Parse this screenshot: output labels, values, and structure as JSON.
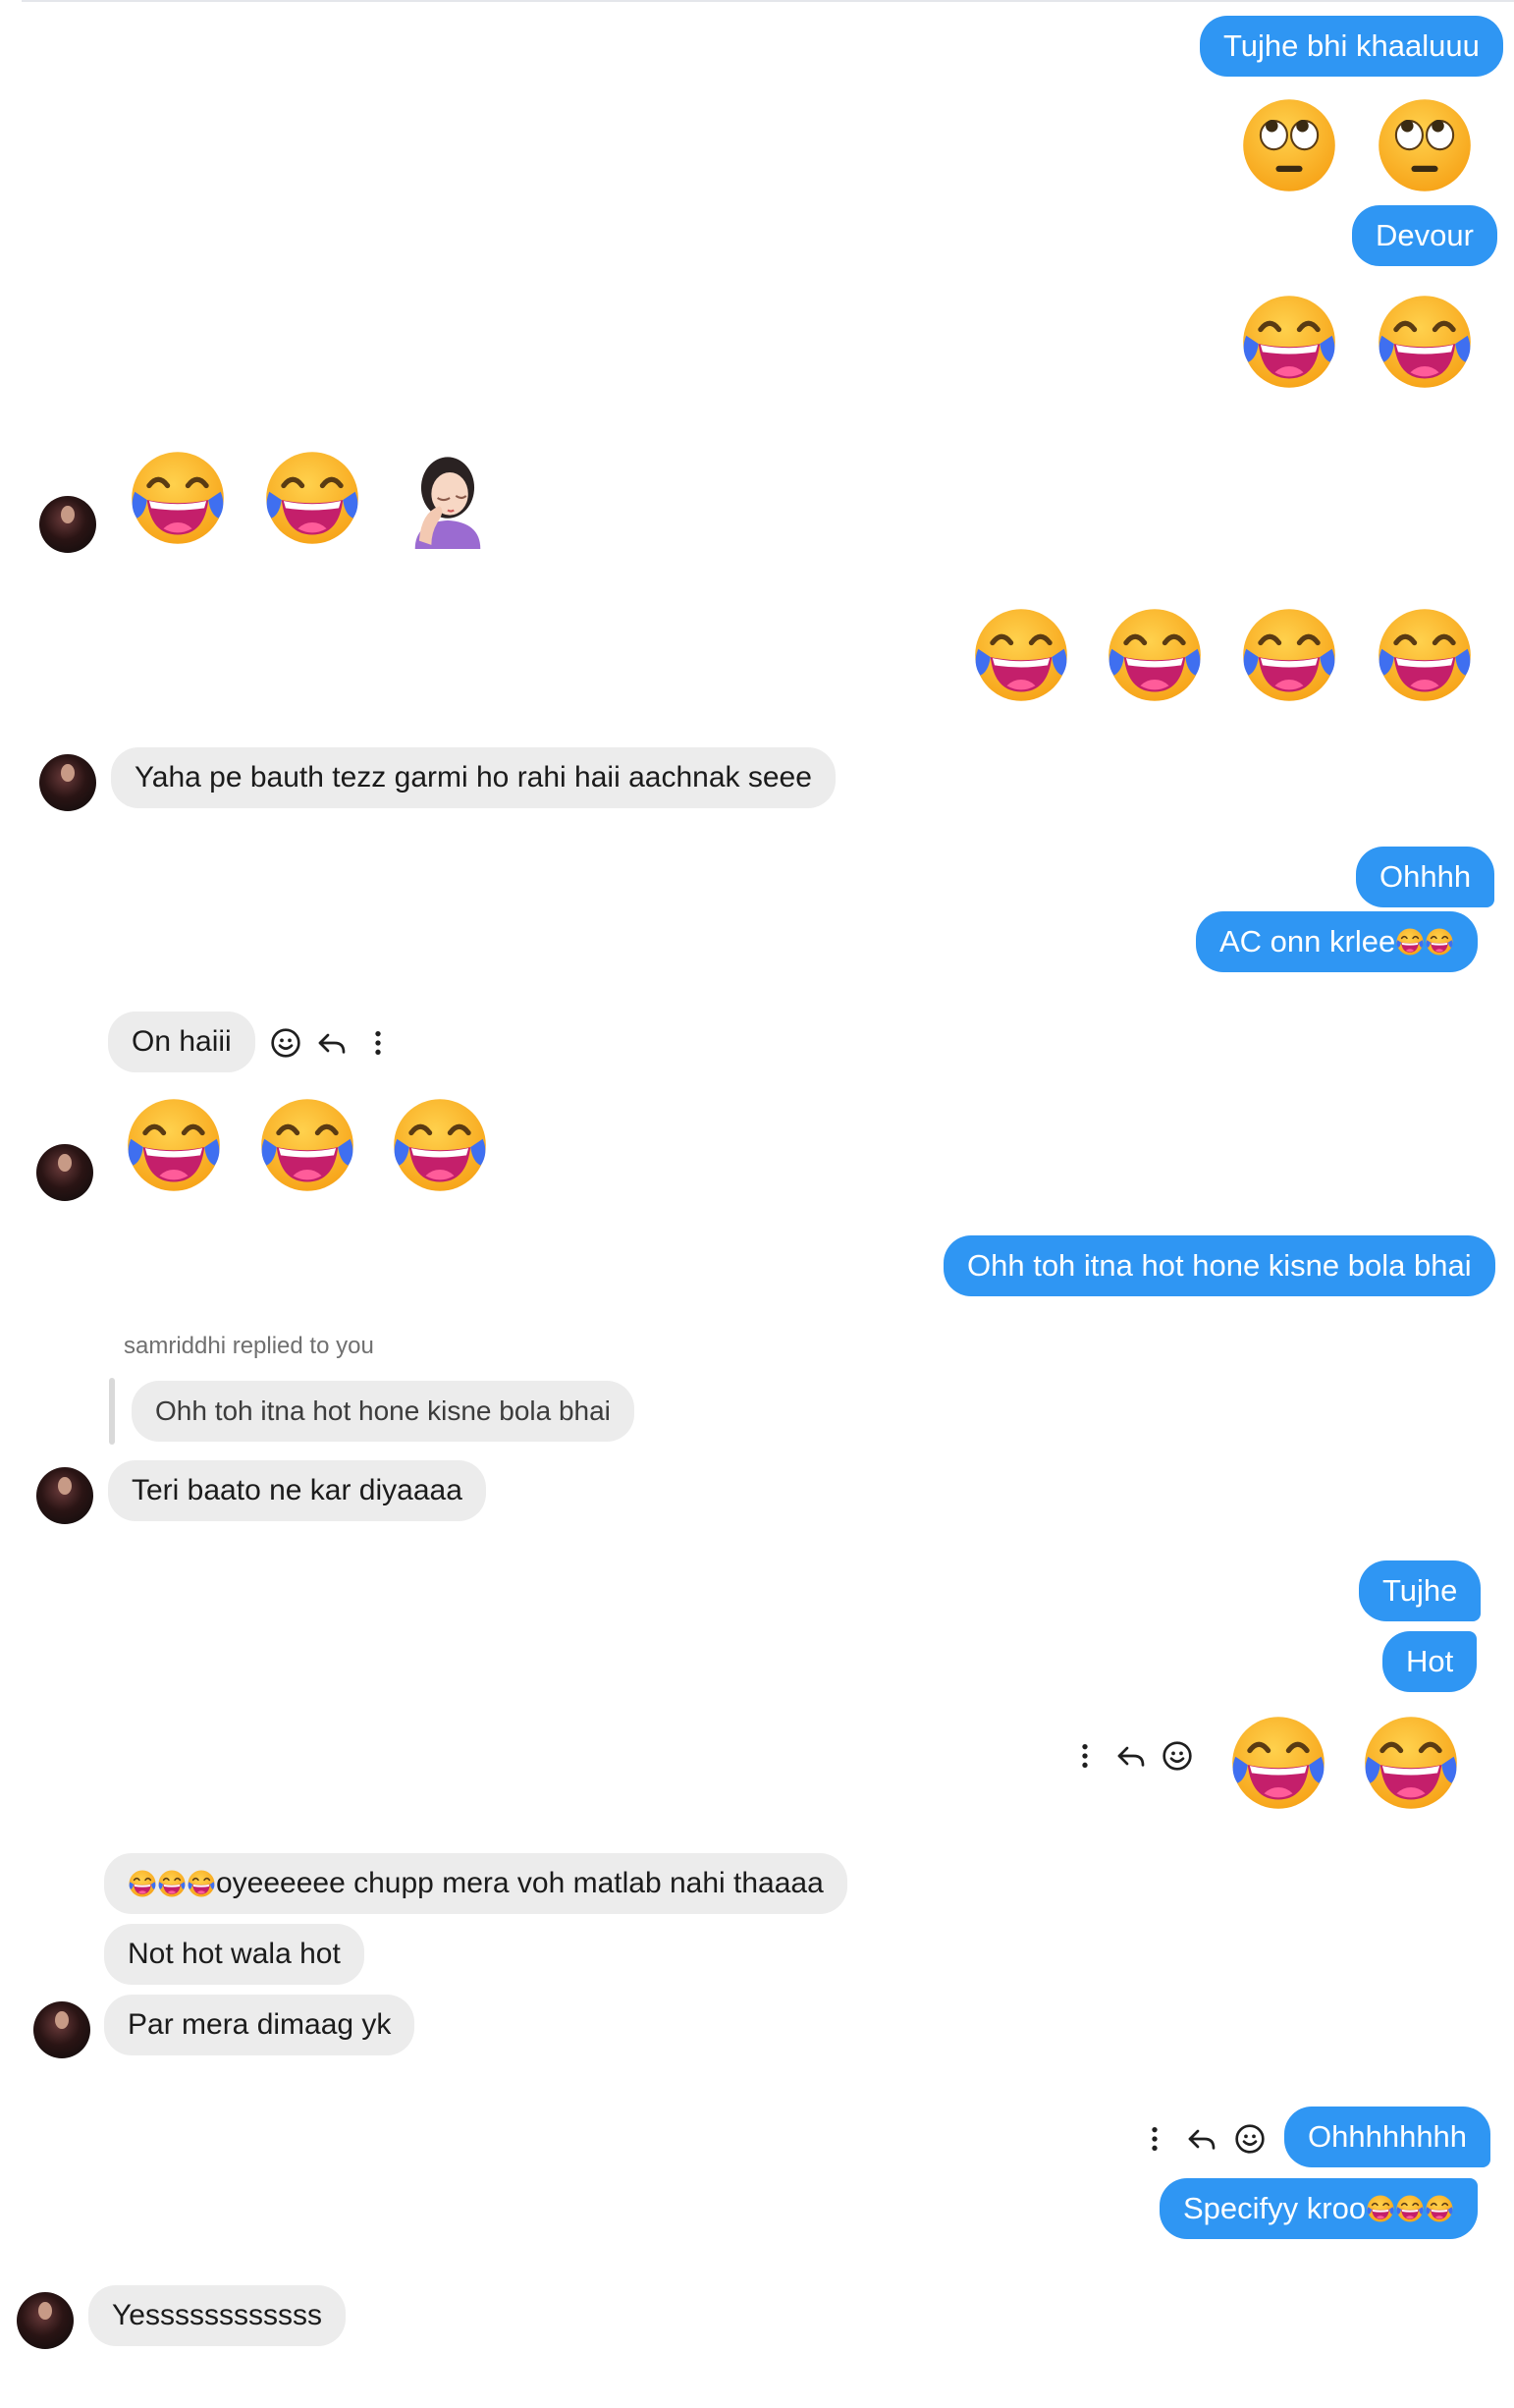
{
  "messages": {
    "m1": "Tujhe bhi khaaluuu",
    "m2": "Devour",
    "m3": "Yaha pe bauth tezz garmi ho rahi haii aachnak seee",
    "m4": "Ohhhh",
    "m5": "AC onn krlee",
    "m6": "On haiii",
    "m7": "Ohh toh itna hot hone kisne bola bhai",
    "m8_note": "samriddhi replied to you",
    "m8_quote": "Ohh toh itna hot hone kisne bola bhai",
    "m8": "Teri baato ne kar diyaaaa",
    "m9": "Tujhe",
    "m10": "Hot",
    "m11": "oyeeeeee chupp mera voh matlab nahi thaaaa",
    "m12": "Not hot wala hot",
    "m13": "Par mera dimaag yk",
    "m14": "Ohhhhhhhh",
    "m15": "Specifyy kroo",
    "m16": "Yessssssssssss"
  },
  "icons": {
    "emoji_main": "face-with-tears-of-joy",
    "emoji_eyeroll": "face-with-rolling-eyes",
    "emoji_facepalm": "woman-facepalming",
    "action_icons": [
      "react-icon",
      "reply-icon",
      "more-icon"
    ]
  },
  "colors": {
    "outgoing": "#2f96f3",
    "incoming": "#ececec"
  }
}
